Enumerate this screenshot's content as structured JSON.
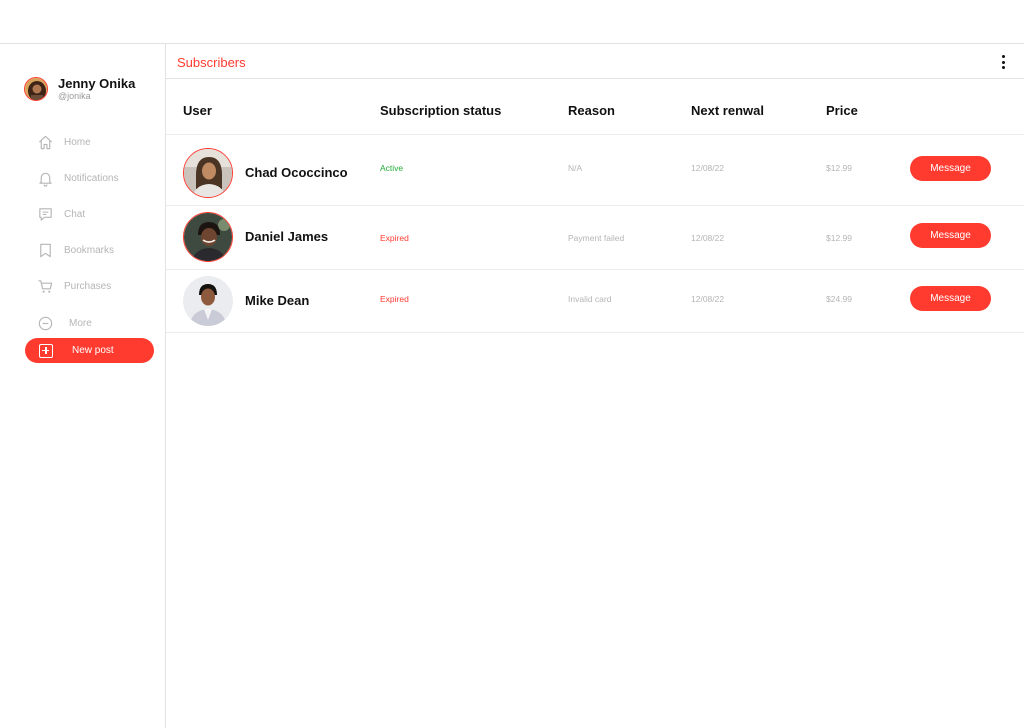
{
  "colors": {
    "accent": "#ff3b30",
    "active": "#27ae3a",
    "muted": "#b5b5b5"
  },
  "profile": {
    "name": "Jenny Onika",
    "handle": "@jonika"
  },
  "nav": [
    {
      "label": "Home",
      "icon": "home-icon"
    },
    {
      "label": "Notifications",
      "icon": "bell-icon"
    },
    {
      "label": "Chat",
      "icon": "chat-icon"
    },
    {
      "label": "Bookmarks",
      "icon": "bookmark-icon"
    },
    {
      "label": "Purchases",
      "icon": "cart-icon"
    },
    {
      "label": "More",
      "icon": "more-icon"
    }
  ],
  "new_post": {
    "label": "New post",
    "icon": "plus-square-icon"
  },
  "page": {
    "title": "Subscribers",
    "menu_icon": "kebab-menu-icon"
  },
  "table": {
    "columns": [
      "User",
      "Subscription status",
      "Reason",
      "Next renwal",
      "Price"
    ],
    "rows": [
      {
        "name": "Chad Ococcinco",
        "status": "Active",
        "status_color": "#27ae3a",
        "reason": "N/A",
        "next": "12/08/22",
        "price": "$12.99",
        "action": "Message"
      },
      {
        "name": "Daniel James",
        "status": "Expired",
        "status_color": "#ff3b30",
        "reason": "Payment failed",
        "next": "12/08/22",
        "price": "$12.99",
        "action": "Message"
      },
      {
        "name": "Mike Dean",
        "status": "Expired",
        "status_color": "#ff3b30",
        "reason": "Invalid card",
        "next": "12/08/22",
        "price": "$24.99",
        "action": "Message"
      }
    ]
  }
}
